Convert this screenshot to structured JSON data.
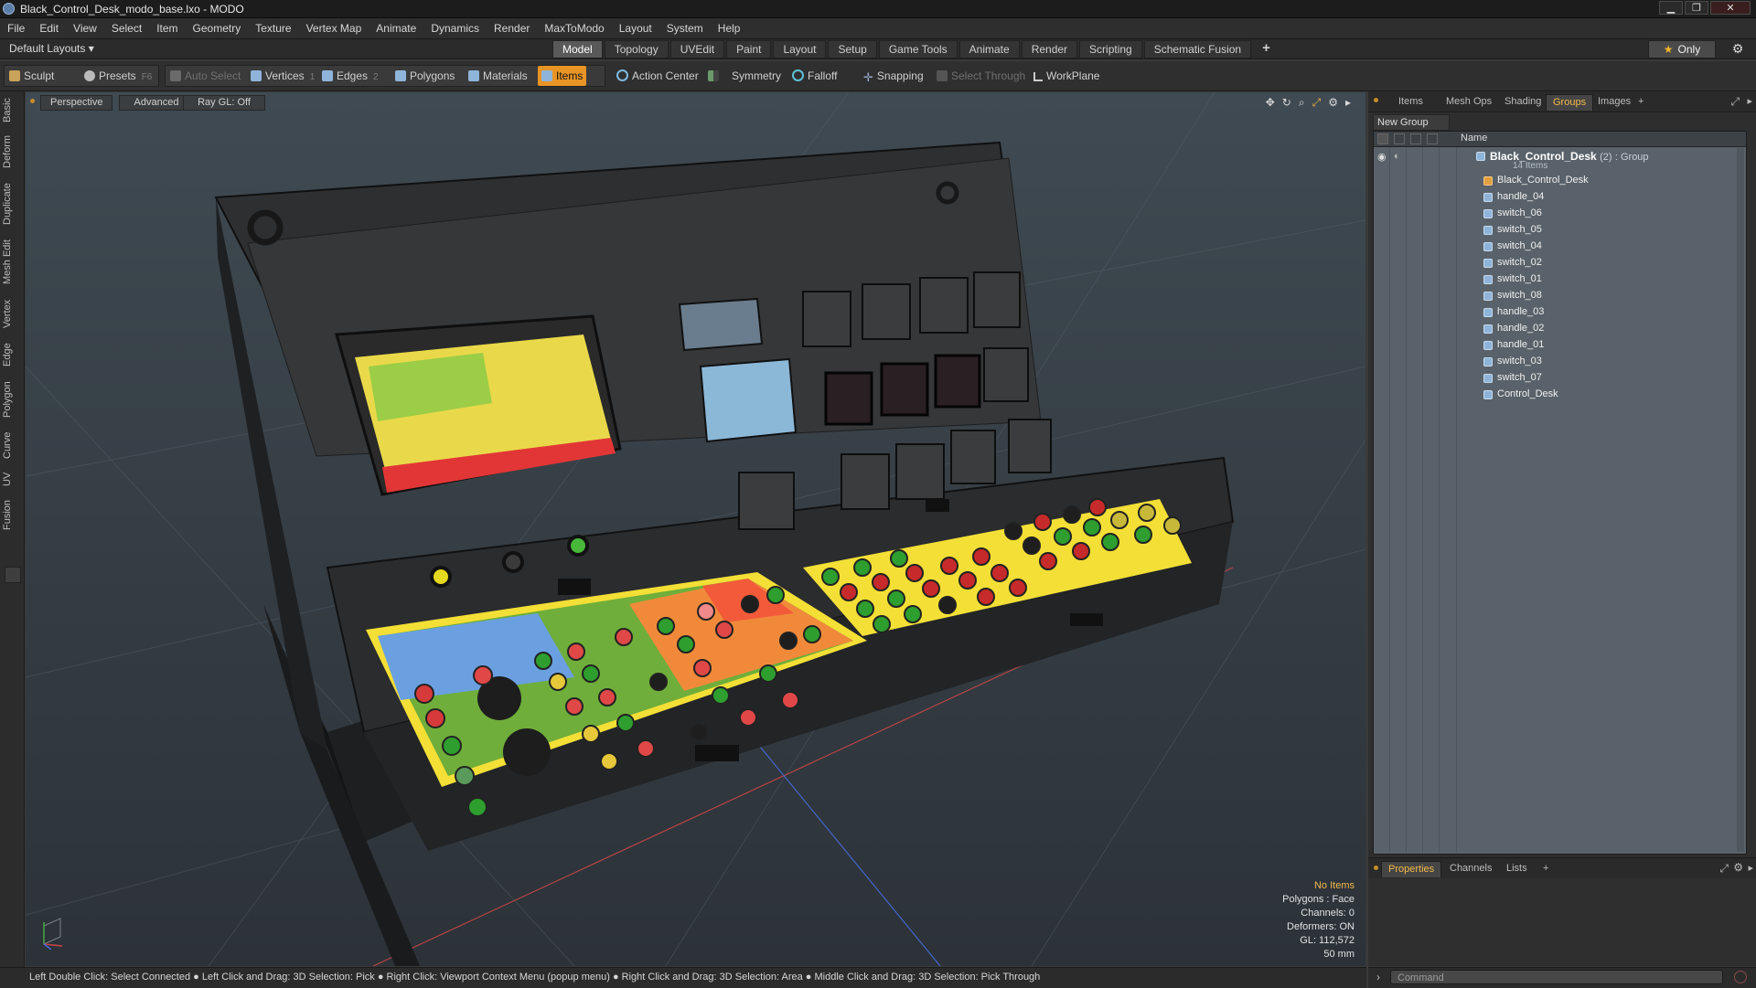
{
  "window": {
    "title": "Black_Control_Desk_modo_base.lxo - MODO",
    "min": "▁",
    "max": "❐",
    "close": "✕"
  },
  "menu": [
    "File",
    "Edit",
    "View",
    "Select",
    "Item",
    "Geometry",
    "Texture",
    "Vertex Map",
    "Animate",
    "Dynamics",
    "Render",
    "MaxToModo",
    "Layout",
    "System",
    "Help"
  ],
  "layoutbar": {
    "layouts": "Default Layouts ▾",
    "tabs": [
      "Model",
      "Topology",
      "UVEdit",
      "Paint",
      "Layout",
      "Setup",
      "Game Tools",
      "Animate",
      "Render",
      "Scripting",
      "Schematic Fusion"
    ],
    "active_tab": "Model",
    "plus": "+",
    "only": "Only"
  },
  "toolbar": {
    "sculpt": "Sculpt",
    "presets": "Presets",
    "presets_key": "F6",
    "auto_select": "Auto Select",
    "vertices": "Vertices",
    "vertices_key": "1",
    "edges": "Edges",
    "edges_key": "2",
    "polygons": "Polygons",
    "materials": "Materials",
    "items": "Items",
    "action_center": "Action Center",
    "symmetry": "Symmetry",
    "falloff": "Falloff",
    "snapping": "Snapping",
    "select_through": "Select Through",
    "workplane": "WorkPlane"
  },
  "lefttabs": [
    "Basic",
    "Deform",
    "Duplicate",
    "Mesh Edit",
    "Vertex",
    "Edge",
    "Polygon",
    "Curve",
    "UV",
    "Fusion"
  ],
  "viewport": {
    "view": "Perspective",
    "shading": "Advanced",
    "raygl": "Ray GL: Off",
    "info": {
      "no_items": "No Items",
      "polygons": "Polygons : Face",
      "channels": "Channels: 0",
      "deformers": "Deformers: ON",
      "gl": "GL: 112,572",
      "mm": "50 mm"
    }
  },
  "rightpanel": {
    "tabs": [
      "Items",
      "Mesh Ops",
      "Shading",
      "Groups",
      "Images",
      "+"
    ],
    "active_tab": "Groups",
    "new_group": "New Group",
    "col_name": "Name",
    "group": {
      "name": "Black_Control_Desk",
      "count": "(2)",
      "type": ": Group",
      "items": "14 Items"
    },
    "items": [
      "Black_Control_Desk",
      "handle_04",
      "switch_06",
      "switch_05",
      "switch_04",
      "switch_02",
      "switch_01",
      "switch_08",
      "handle_03",
      "handle_02",
      "handle_01",
      "switch_03",
      "switch_07",
      "Control_Desk"
    ],
    "bottom_tabs": [
      "Properties",
      "Channels",
      "Lists",
      "+"
    ],
    "command_placeholder": "Command"
  },
  "status": "Left Double Click: Select Connected ● Left Click and Drag: 3D Selection: Pick ● Right Click: Viewport Context Menu (popup menu) ● Right Click and Drag: 3D Selection: Area ● Middle Click and Drag: 3D Selection: Pick Through",
  "colors": {
    "accent": "#e89525",
    "group_tab": "#f2b84a",
    "panel_yellow": "#f5e03a",
    "panel_green": "#6fae3a",
    "panel_orange": "#f08a3a"
  }
}
